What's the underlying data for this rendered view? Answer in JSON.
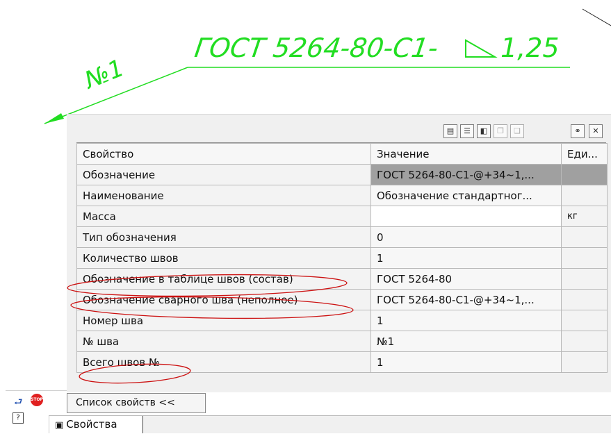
{
  "drawing": {
    "callout_text": "ГОСТ 5264-80-С1-",
    "callout_leg": "1,25",
    "weld_number": "№1"
  },
  "table": {
    "headers": [
      "Свойство",
      "Значение",
      "Еди..."
    ],
    "rows": [
      {
        "property": "Обозначение",
        "value": "ГОСТ 5264-80-С1-@+34~1,...",
        "unit": ""
      },
      {
        "property": "Наименование",
        "value": "Обозначение стандартног...",
        "unit": ""
      },
      {
        "property": "Масса",
        "value": "",
        "unit": "кг"
      },
      {
        "property": "Тип обозначения",
        "value": "0",
        "unit": ""
      },
      {
        "property": "Количество швов",
        "value": "1",
        "unit": ""
      },
      {
        "property": "Обозначение в таблице швов (состав)",
        "value": "ГОСТ 5264-80",
        "unit": ""
      },
      {
        "property": "Обозначение сварного шва (неполное)",
        "value": "ГОСТ 5264-80-С1-@+34~1,...",
        "unit": ""
      },
      {
        "property": "Номер шва",
        "value": "1",
        "unit": ""
      },
      {
        "property": "№ шва",
        "value": "№1",
        "unit": ""
      },
      {
        "property": "Всего швов №",
        "value": "1",
        "unit": ""
      }
    ]
  },
  "toolbar_icons": [
    "properties-list-icon",
    "list-view-icon",
    "book-icon",
    "copy-icon",
    "copy-all-icon",
    "link-icon",
    "close-table-icon"
  ],
  "panel": {
    "collapse_label": "Список свойств  <<",
    "tab_label": "Свойства"
  },
  "colors": {
    "drawing_green": "#22dd22",
    "annotation_red": "#cc1111",
    "selected_cell": "#a0a0a0"
  }
}
